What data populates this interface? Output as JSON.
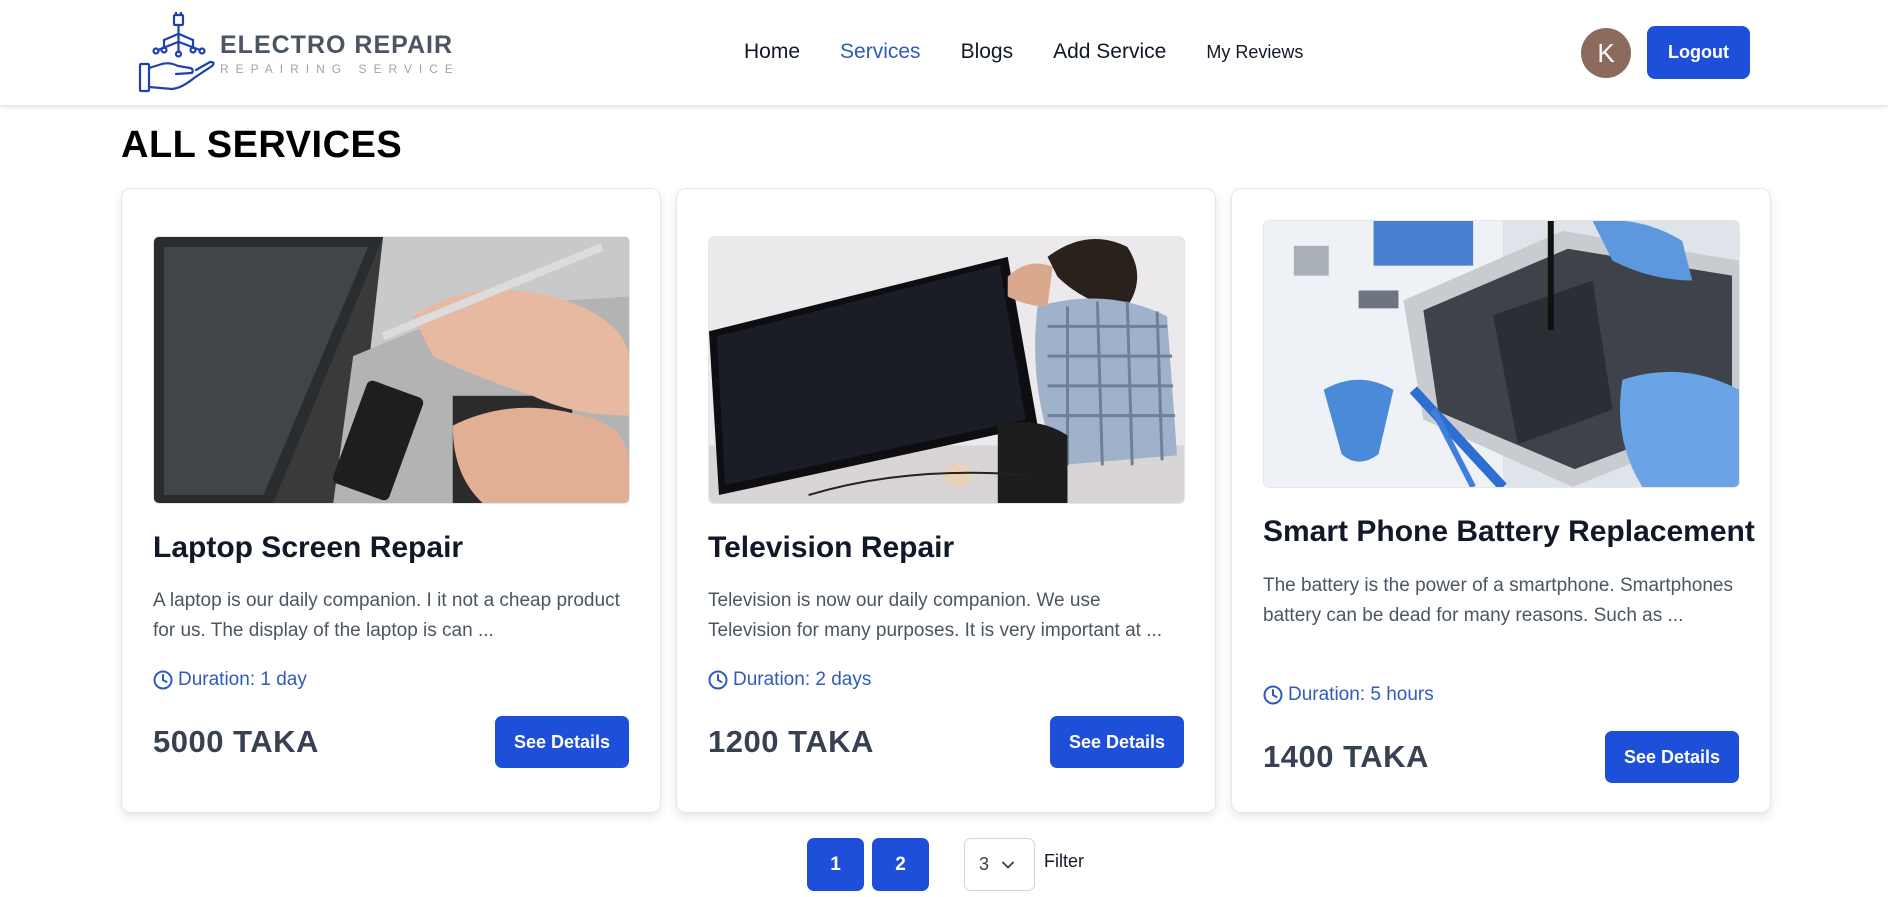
{
  "brand": {
    "title": "ELECTRO REPAIR",
    "subtitle": "REPAIRING SERVICE",
    "icon": "plug-hand-logo"
  },
  "nav": {
    "items": [
      {
        "label": "Home",
        "active": false
      },
      {
        "label": "Services",
        "active": true
      },
      {
        "label": "Blogs",
        "active": false
      },
      {
        "label": "Add Service",
        "active": false
      },
      {
        "label": "My Reviews",
        "active": false
      }
    ],
    "avatar_initial": "K",
    "logout_label": "Logout",
    "accent_color": "#1d4fd8"
  },
  "page": {
    "title": "ALL SERVICES"
  },
  "services": [
    {
      "title": "Laptop Screen Repair",
      "description": "A laptop is our daily companion. I it not a cheap product for us. The display of the laptop is can ...",
      "duration": "Duration: 1 day",
      "price": "5000 TAKA",
      "button": "See Details",
      "image": "laptop-repair-photo"
    },
    {
      "title": "Television Repair",
      "description": "Television is now our daily companion. We use Television for many purposes. It is very important at ...",
      "duration": "Duration: 2 days",
      "price": "1200 TAKA",
      "button": "See Details",
      "image": "television-repair-photo"
    },
    {
      "title": "Smart Phone Battery Replacement",
      "description": "The battery is the power of a smartphone. Smartphones battery can be dead for many reasons. Such as ...",
      "duration": "Duration: 5 hours",
      "price": "1400 TAKA",
      "button": "See Details",
      "image": "phone-battery-photo"
    }
  ],
  "pagination": {
    "pages": [
      "1",
      "2"
    ],
    "per_page": "3",
    "filter_label": "Filter"
  }
}
